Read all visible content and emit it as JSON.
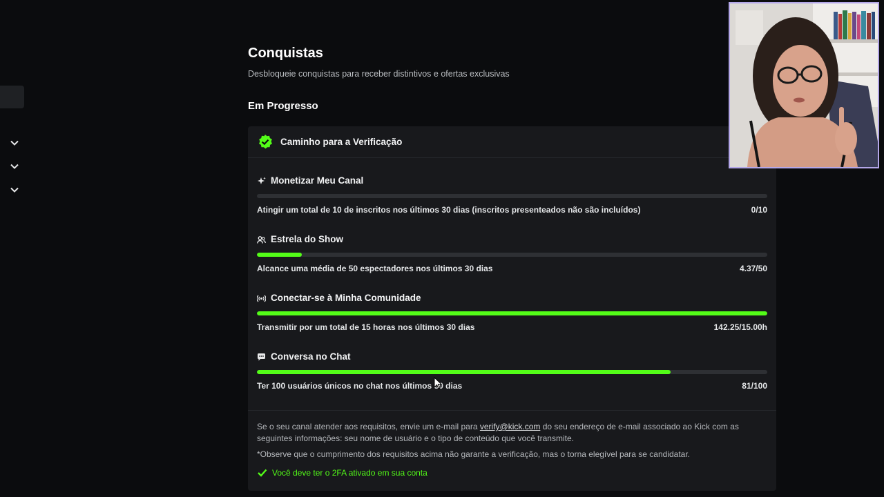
{
  "header": {
    "title": "Conquistas",
    "subtitle": "Desbloqueie conquistas para receber distintivos e ofertas exclusivas",
    "section": "Em Progresso"
  },
  "sidebar": {
    "icons": [
      "chevron-down-icon",
      "chevron-down-icon",
      "chevron-down-icon"
    ]
  },
  "card": {
    "title": "Caminho para a Verificação",
    "icon": "verified-badge-icon",
    "achievements": [
      {
        "icon": "sparkle-icon",
        "title": "Monetizar Meu Canal",
        "description": "Atingir um total de 10 de inscritos nos últimos 30 dias (inscritos presenteados não são incluídos)",
        "value": "0/10",
        "progress": 0
      },
      {
        "icon": "users-icon",
        "title": "Estrela do Show",
        "description": "Alcance uma média de 50 espectadores nos últimos 30 dias",
        "value": "4.37/50",
        "progress": 0.0874
      },
      {
        "icon": "broadcast-icon",
        "title": "Conectar-se à Minha Comunidade",
        "description": "Transmitir por um total de 15 horas nos últimos 30 dias",
        "value": "142.25/15.00h",
        "progress": 1
      },
      {
        "icon": "chat-bubble-icon",
        "title": "Conversa no Chat",
        "description": "Ter 100 usuários únicos no chat nos últimos 30 dias",
        "value": "81/100",
        "progress": 0.81
      }
    ],
    "info_prefix": "Se o seu canal atender aos requisitos, envie um e-mail para ",
    "info_email": "verify@kick.com",
    "info_suffix": " do seu endereço de e-mail associado ao Kick com as seguintes informações: seu nome de usuário e o tipo de conteúdo que você transmite.",
    "note": "*Observe que o cumprimento dos requisitos acima não garante a verificação, mas o torna elegível para se candidatar.",
    "requirement": "Você deve ter o 2FA ativado em sua conta"
  },
  "colors": {
    "accent": "#53fc18",
    "background": "#0b0c0e",
    "card": "#18191c",
    "track": "#2e3034",
    "webcam_border": "#b3a6e8"
  }
}
